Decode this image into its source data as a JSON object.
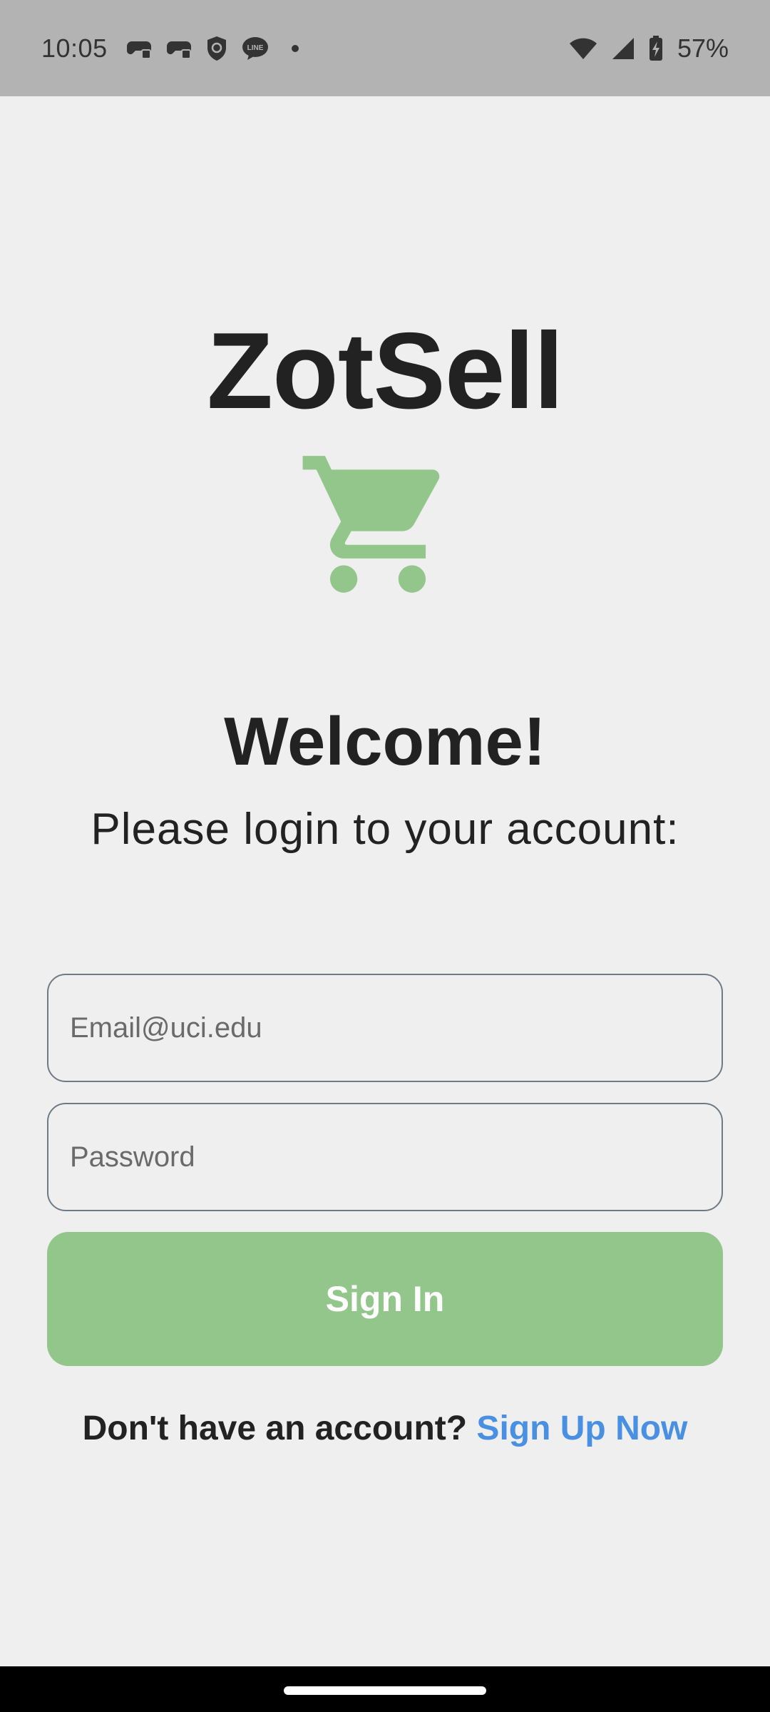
{
  "status_bar": {
    "time": "10:05",
    "battery": "57%",
    "notification_icons": [
      "game-controller-icon",
      "game-controller-icon",
      "shield-icon",
      "line-chat-icon"
    ]
  },
  "app": {
    "title": "ZotSell",
    "logo_icon": "shopping-cart-icon",
    "accent_color": "#93c68a",
    "link_color": "#4a90e2"
  },
  "login": {
    "welcome": "Welcome!",
    "subtitle": "Please login to your account:",
    "email_placeholder": "Email@uci.edu",
    "password_placeholder": "Password",
    "signin_label": "Sign In",
    "signup_prompt": "Don't have an account? ",
    "signup_link": "Sign Up Now"
  }
}
